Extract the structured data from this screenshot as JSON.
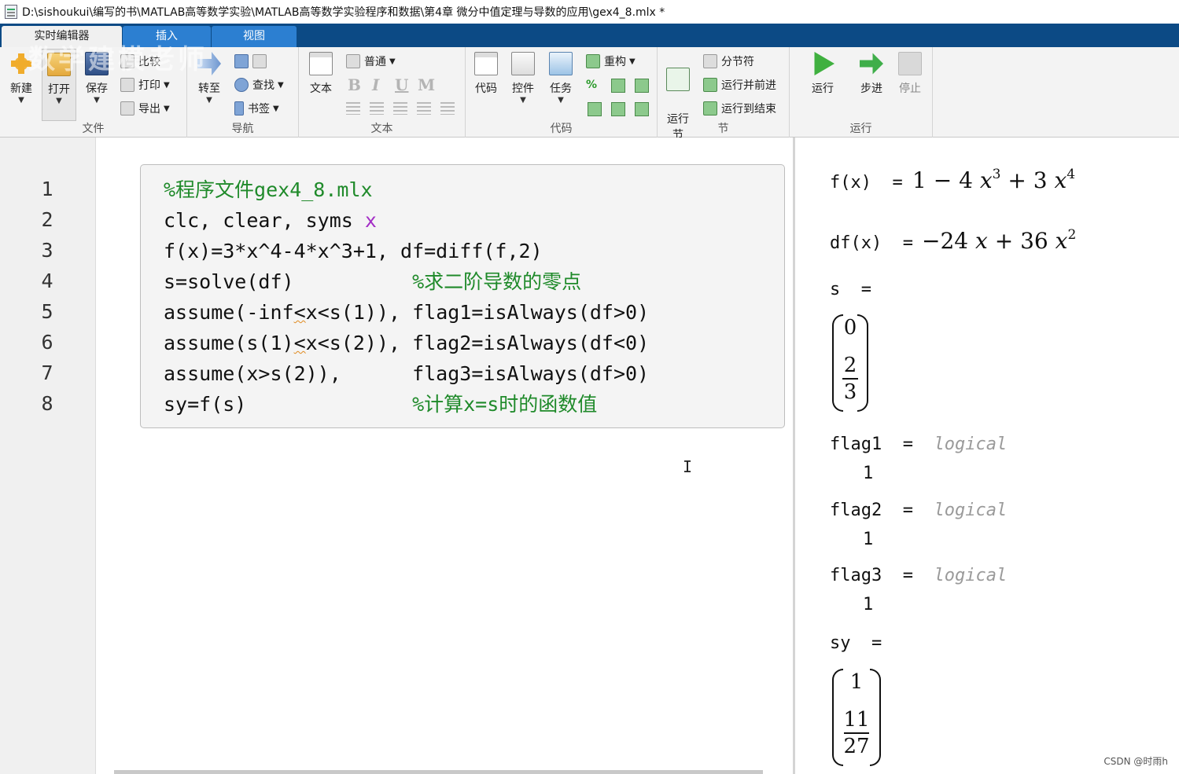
{
  "window": {
    "title": "D:\\sishoukui\\编写的书\\MATLAB高等数学实验\\MATLAB高等数学实验程序和数据\\第4章  微分中值定理与导数的应用\\gex4_8.mlx *"
  },
  "tabs": [
    "实时编辑器",
    "插入",
    "视图"
  ],
  "watermark": "数学建模老师",
  "ribbon": {
    "file": {
      "label": "文件",
      "new": "新建",
      "open": "打开",
      "save": "保存",
      "compare": "比较",
      "print": "打印",
      "export": "导出"
    },
    "nav": {
      "label": "导航",
      "goto": "转至",
      "find": "查找",
      "bookmark": "书签"
    },
    "text": {
      "label": "文本",
      "text_btn": "文本",
      "style": "普通",
      "bold": "B",
      "italic": "I",
      "underline": "U",
      "mono": "M"
    },
    "code": {
      "label": "代码",
      "code_btn": "代码",
      "control": "控件",
      "task": "任务",
      "refactor": "重构",
      "percent": "%"
    },
    "section": {
      "label": "节",
      "run_section": "运行\n节",
      "section_break": "分节符",
      "run_advance": "运行并前进",
      "run_to_end": "运行到结束"
    },
    "run": {
      "label": "运行",
      "run": "运行",
      "step": "步进",
      "stop": "停止"
    }
  },
  "editor": {
    "line_numbers": [
      "1",
      "2",
      "3",
      "4",
      "5",
      "6",
      "7",
      "8"
    ],
    "lines": [
      {
        "segments": [
          {
            "t": "%程序文件gex4_8.mlx",
            "c": "cmt"
          }
        ]
      },
      {
        "segments": [
          {
            "t": "clc, clear, syms ",
            "c": ""
          },
          {
            "t": "x",
            "c": "sym"
          }
        ]
      },
      {
        "segments": [
          {
            "t": "f(x)=3*x^4-4*x^3+1, df=diff(f,2)",
            "c": ""
          }
        ]
      },
      {
        "segments": [
          {
            "t": "s=solve(df)          ",
            "c": ""
          },
          {
            "t": "%求二阶导数的零点",
            "c": "cmt"
          }
        ]
      },
      {
        "segments": [
          {
            "t": "assume(-inf",
            "c": ""
          },
          {
            "t": "<",
            "c": "squig"
          },
          {
            "t": "x<s(1)), flag1=isAlways(df>0)",
            "c": ""
          }
        ]
      },
      {
        "segments": [
          {
            "t": "assume(s(1)",
            "c": ""
          },
          {
            "t": "<",
            "c": "squig"
          },
          {
            "t": "x<s(2)), flag2=isAlways(df<0)",
            "c": ""
          }
        ]
      },
      {
        "segments": [
          {
            "t": "assume(x>s(2)),      flag3=isAlways(df>0)",
            "c": ""
          }
        ]
      },
      {
        "segments": [
          {
            "t": "sy=f(s)              ",
            "c": ""
          },
          {
            "t": "%计算x=s时的函数值",
            "c": "cmt"
          }
        ]
      }
    ],
    "cursor": "I"
  },
  "output": {
    "f_label": "f(x)  =",
    "f_expr": {
      "c1": "1",
      "op1": "−",
      "c2": "4",
      "v": "x",
      "e1": "3",
      "op2": "+",
      "c3": "3",
      "e2": "4"
    },
    "df_label": "df(x)  =",
    "df_expr": {
      "sign": "−",
      "c1": "24",
      "v": "x",
      "op": "+",
      "c2": "36",
      "e": "2"
    },
    "s_label": "s  =",
    "s_values": {
      "v0": "0",
      "num": "2",
      "den": "3"
    },
    "flags": [
      {
        "label": "flag1  =",
        "type": "logical",
        "value": "1"
      },
      {
        "label": "flag2  =",
        "type": "logical",
        "value": "1"
      },
      {
        "label": "flag3  =",
        "type": "logical",
        "value": "1"
      }
    ],
    "sy_label": "sy  =",
    "sy_values": {
      "v0": "1",
      "num": "11",
      "den": "27"
    }
  },
  "credit": "CSDN @时雨h"
}
